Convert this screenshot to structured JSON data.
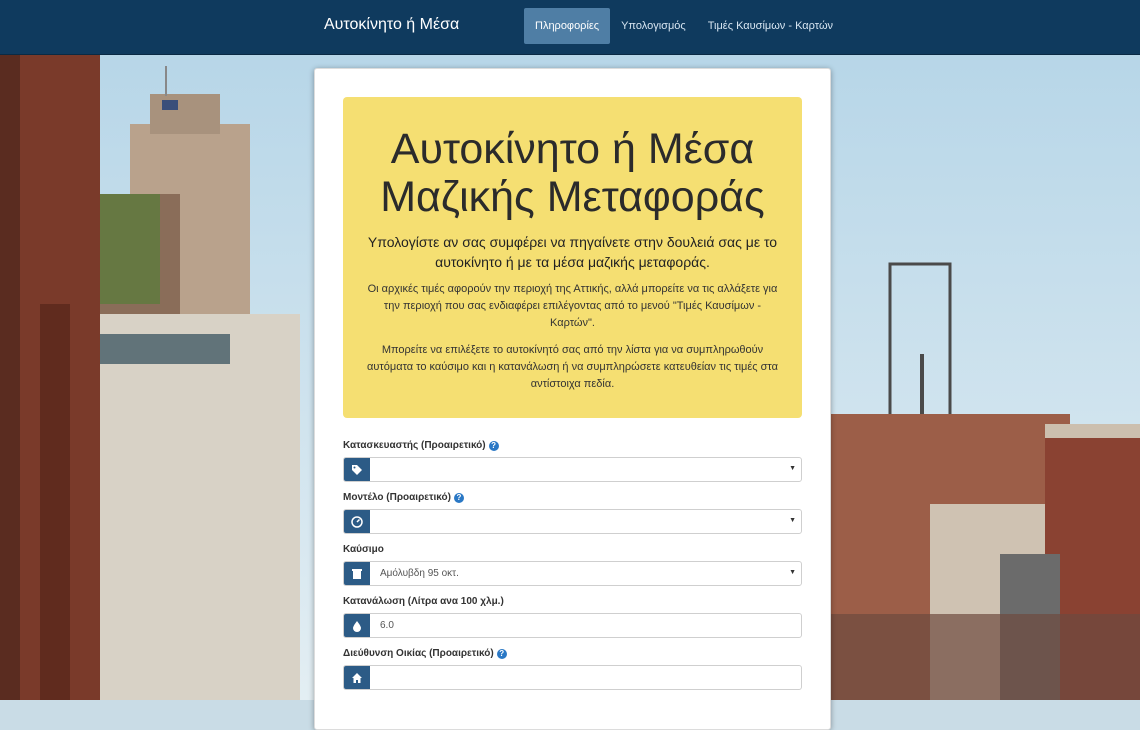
{
  "navbar": {
    "brand": "Αυτοκίνητο ή Μέσα",
    "items": [
      {
        "label": "Πληροφορίες",
        "active": true
      },
      {
        "label": "Υπολογισμός",
        "active": false
      },
      {
        "label": "Τιμές Καυσίμων - Καρτών",
        "active": false
      }
    ]
  },
  "jumbotron": {
    "title_line1": "Αυτοκίνητο ή Μέσα",
    "title_line2": "Μαζικής Μεταφοράς",
    "lead": "Υπολογίστε αν σας συμφέρει να πηγαίνετε στην δουλειά σας με το αυτοκίνητο ή με τα μέσα μαζικής μεταφοράς.",
    "paragraph1": "Οι αρχικές τιμές αφορούν την περιοχή της Αττικής, αλλά μπορείτε να τις αλλάξετε για την περιοχή που σας ενδιαφέρει επιλέγοντας από το μενού \"Τιμές Καυσίμων - Καρτών\".",
    "paragraph2": "Μπορείτε να επιλέξετε το αυτοκίνητό σας από την λίστα για να συμπληρωθούν αυτόματα το καύσιμο και η κατανάλωση ή να συμπληρώσετε κατευθείαν τις τιμές στα αντίστοιχα πεδία."
  },
  "form": {
    "manufacturer": {
      "label": "Κατασκευαστής (Προαιρετικό)",
      "value": "",
      "icon": "tag-icon"
    },
    "model": {
      "label": "Μοντέλο (Προαιρετικό)",
      "value": "",
      "icon": "dashboard-icon"
    },
    "fuel": {
      "label": "Καύσιμο",
      "value": "Αμόλυβδη 95 οκτ.",
      "icon": "fuel-pump-icon"
    },
    "consumption": {
      "label": "Κατανάλωση (Λίτρα ανα 100 χλμ.)",
      "value": "6.0",
      "icon": "drop-icon"
    },
    "home_address": {
      "label": "Διεύθυνση Οικίας (Προαιρετικό)",
      "value": "",
      "icon": "home-icon"
    }
  },
  "colors": {
    "navbar": "#0f3a5e",
    "nav_active": "#4f7ea5",
    "jumbotron": "#f5df72",
    "addon": "#2c5b86",
    "help_icon": "#2a78c5"
  }
}
